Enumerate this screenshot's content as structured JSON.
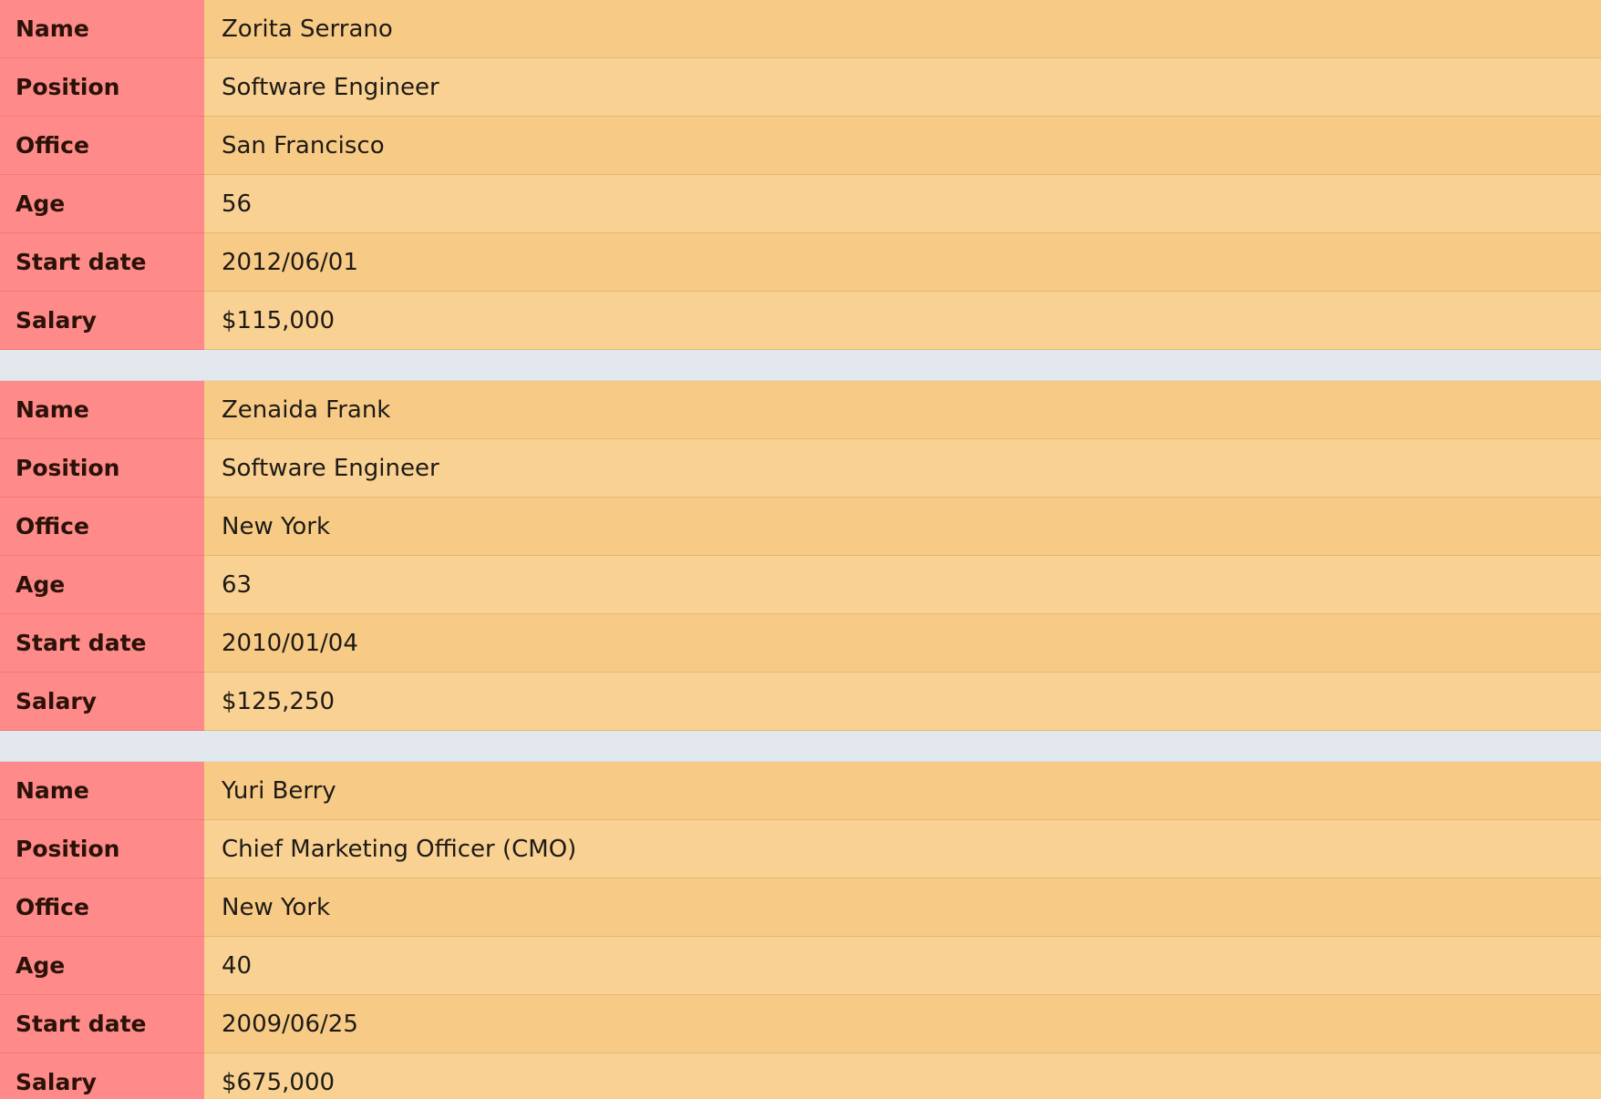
{
  "labels": {
    "name": "Name",
    "position": "Position",
    "office": "Office",
    "age": "Age",
    "start_date": "Start date",
    "salary": "Salary"
  },
  "records": [
    {
      "name": "Zorita Serrano",
      "position": "Software Engineer",
      "office": "San Francisco",
      "age": "56",
      "start_date": "2012/06/01",
      "salary": "$115,000"
    },
    {
      "name": "Zenaida Frank",
      "position": "Software Engineer",
      "office": "New York",
      "age": "63",
      "start_date": "2010/01/04",
      "salary": "$125,250"
    },
    {
      "name": "Yuri Berry",
      "position": "Chief Marketing Officer (CMO)",
      "office": "New York",
      "age": "40",
      "start_date": "2009/06/25",
      "salary": "$675,000"
    }
  ],
  "colors": {
    "label_bg": "#ff8a8a",
    "value_bg_odd": "#f7cb86",
    "value_bg_even": "#f9d293",
    "separator": "#e3e8ef"
  }
}
